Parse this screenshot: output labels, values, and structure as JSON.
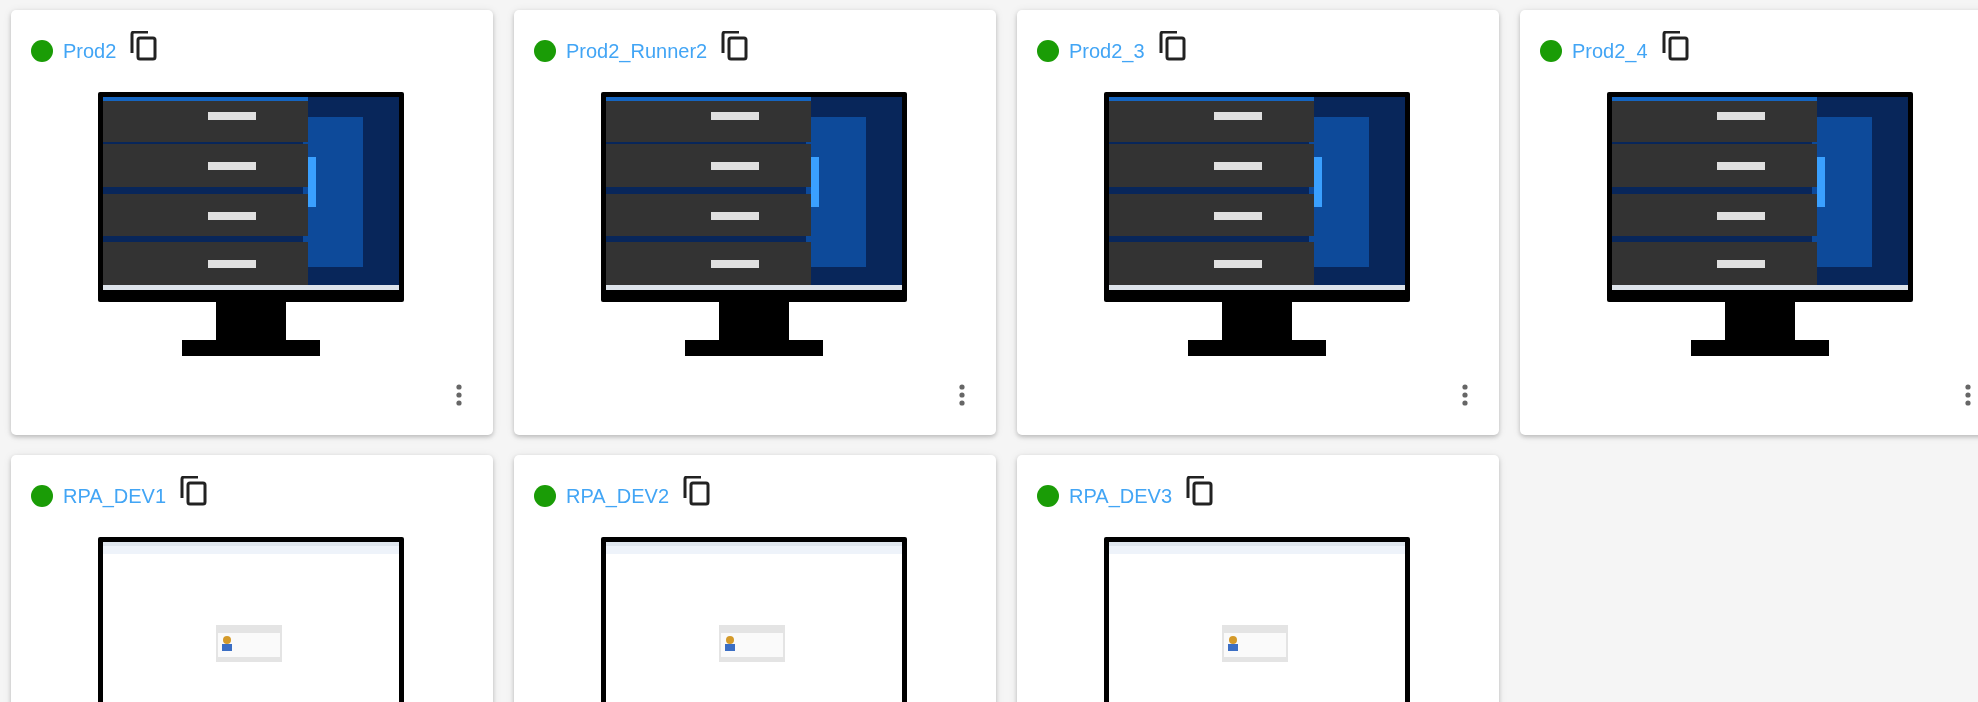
{
  "machines": [
    {
      "name": "Prod2",
      "online": true,
      "kind": "desktop"
    },
    {
      "name": "Prod2_Runner2",
      "online": true,
      "kind": "desktop"
    },
    {
      "name": "Prod2_3",
      "online": true,
      "kind": "desktop"
    },
    {
      "name": "Prod2_4",
      "online": true,
      "kind": "desktop"
    },
    {
      "name": "RPA_DEV1",
      "online": true,
      "kind": "browser"
    },
    {
      "name": "RPA_DEV2",
      "online": true,
      "kind": "browser"
    },
    {
      "name": "RPA_DEV3",
      "online": true,
      "kind": "browser"
    }
  ]
}
